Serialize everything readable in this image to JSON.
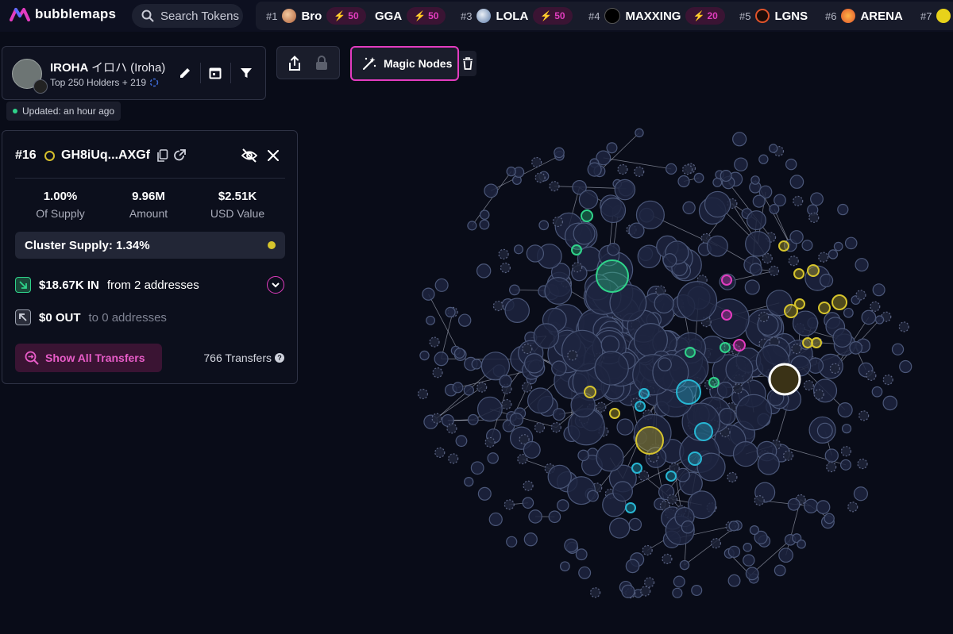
{
  "app": {
    "name": "bubblemaps"
  },
  "search": {
    "label": "Search Tokens"
  },
  "ticker": [
    {
      "rank": "#1",
      "name": "Bro",
      "boost": "50"
    },
    {
      "rank": "",
      "name": "GGA",
      "boost": "50"
    },
    {
      "rank": "#3",
      "name": "LOLA",
      "boost": "50"
    },
    {
      "rank": "#4",
      "name": "MAXXING",
      "boost": "20"
    },
    {
      "rank": "#5",
      "name": "LGNS",
      "boost": ""
    },
    {
      "rank": "#6",
      "name": "ARENA",
      "boost": ""
    },
    {
      "rank": "#7",
      "name": "",
      "boost": ""
    }
  ],
  "token": {
    "name": "IROHA",
    "jp_name": "イロハ (Iroha)",
    "holders": "Top 250 Holders + 219"
  },
  "updated": "Updated: an hour ago",
  "toolbar": {
    "magic_label": "Magic Nodes"
  },
  "holder": {
    "rank": "#16",
    "address": "GH8iUq...AXGf",
    "stats": [
      {
        "value": "1.00%",
        "label": "Of Supply"
      },
      {
        "value": "9.96M",
        "label": "Amount"
      },
      {
        "value": "$2.51K",
        "label": "USD Value"
      }
    ],
    "cluster_supply": "Cluster Supply: 1.34%",
    "in_amount": "$18.67K IN",
    "in_text": "from 2 addresses",
    "out_amount": "$0 OUT",
    "out_text": "to 0 addresses",
    "show_transfers": "Show All Transfers",
    "transfers_count": "766 Transfers"
  },
  "colors": {
    "accent": "#e33cc0",
    "cluster": "#d6c42c",
    "green": "#2fd38a",
    "cyan": "#27b6d3",
    "bubble": "#1b2440"
  },
  "icons": [
    "bubblemaps-logo-icon",
    "search-icon",
    "bolt-icon",
    "edit-icon",
    "calendar-icon",
    "filter-icon",
    "share-icon",
    "lock-icon",
    "magic-wand-icon",
    "trash-icon",
    "copy-icon",
    "external-link-icon",
    "hide-icon",
    "close-icon",
    "inflow-icon",
    "outflow-icon",
    "chevron-down-icon",
    "transfers-search-icon",
    "help-icon"
  ]
}
